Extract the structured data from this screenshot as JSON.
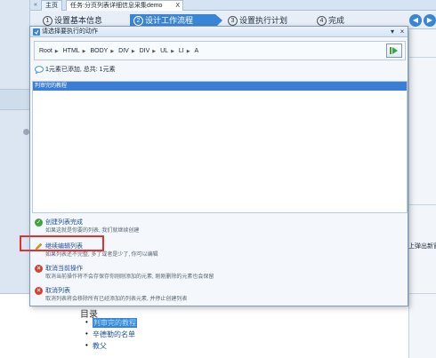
{
  "tabs": {
    "home": "主页",
    "task": "任务:分页列表详细信息采集demo",
    "task_close": "X",
    "nav_left": "«"
  },
  "wizard": {
    "steps": [
      {
        "num": "1",
        "label": "设置基本信息"
      },
      {
        "num": "2",
        "label": "设计工作流程"
      },
      {
        "num": "3",
        "label": "设置执行计划"
      },
      {
        "num": "4",
        "label": "完成"
      }
    ],
    "active_index": 1
  },
  "dialog": {
    "title": "请选择要执行的动作",
    "pin": "▾",
    "close": "×",
    "breadcrumb": [
      "Root",
      "HTML",
      "BODY",
      "DIV",
      "DIV",
      "UL",
      "LI",
      "A"
    ],
    "info": "1元素已添加, 总共: 1元素",
    "list_items": [
      "判审完的教程"
    ],
    "actions": [
      {
        "title": "创建列表完成",
        "desc": "如果这就是你要的列表, 我们就继续创建",
        "icon": "check-icon",
        "color": "#3ca53c"
      },
      {
        "title": "继续编辑列表",
        "desc": "如果列表还不完整, 多了或者是少了, 你可以编辑",
        "icon": "pencil-icon",
        "color": "#e0a020"
      },
      {
        "title": "取消当前操作",
        "desc": "取消当前操作将不会存保存你刚刚添加的元素, 刚刚删除的元素也会保留",
        "icon": "cancel-icon",
        "color": "#d9402f"
      },
      {
        "title": "取消列表",
        "desc": "取消列表将会移除所有已经添加的列表元素, 并停止创建列表",
        "icon": "cancel-icon",
        "color": "#d9402f"
      }
    ]
  },
  "background": {
    "right_text": "上弹出新窗",
    "heading": "目录",
    "bullets": [
      "判审完的教程",
      "辛德勒的名单",
      "教父"
    ]
  },
  "colors": {
    "accent": "#3a86d6",
    "highlight_box": "#e03030"
  }
}
